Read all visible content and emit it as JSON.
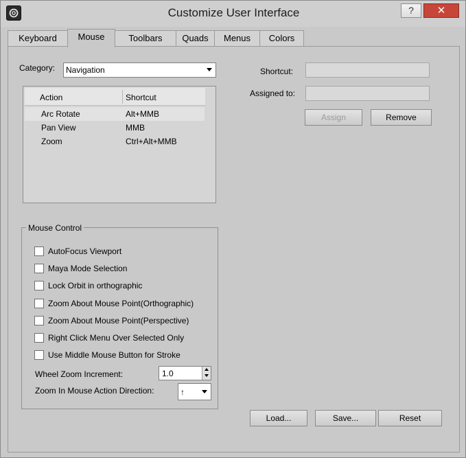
{
  "window": {
    "title": "Customize User Interface",
    "help_glyph": "?",
    "close_glyph": "✕"
  },
  "tabs": [
    {
      "label": "Keyboard"
    },
    {
      "label": "Mouse",
      "active": true
    },
    {
      "label": "Toolbars"
    },
    {
      "label": "Quads"
    },
    {
      "label": "Menus"
    },
    {
      "label": "Colors"
    }
  ],
  "category": {
    "label": "Category:",
    "value": "Navigation"
  },
  "action_list": {
    "columns": [
      "Action",
      "Shortcut"
    ],
    "rows": [
      {
        "action": "Arc Rotate",
        "shortcut": "Alt+MMB",
        "selected": true
      },
      {
        "action": "Pan View",
        "shortcut": "MMB"
      },
      {
        "action": "Zoom",
        "shortcut": "Ctrl+Alt+MMB"
      }
    ]
  },
  "shortcut": {
    "label": "Shortcut:",
    "value": ""
  },
  "assigned_to": {
    "label": "Assigned to:",
    "value": ""
  },
  "buttons": {
    "assign": "Assign",
    "remove": "Remove",
    "load": "Load...",
    "save": "Save...",
    "reset": "Reset"
  },
  "mouse_control": {
    "title": "Mouse Control",
    "options": [
      {
        "label": "AutoFocus Viewport",
        "checked": false
      },
      {
        "label": "Maya Mode Selection",
        "checked": false
      },
      {
        "label": "Lock Orbit in orthographic",
        "checked": false
      },
      {
        "label": "Zoom About Mouse Point(Orthographic)",
        "checked": false
      },
      {
        "label": "Zoom About Mouse Point(Perspective)",
        "checked": false
      },
      {
        "label": "Right Click Menu Over Selected Only",
        "checked": false
      },
      {
        "label": "Use Middle Mouse Button for Stroke",
        "checked": false
      }
    ],
    "wheel_zoom": {
      "label": "Wheel Zoom Increment:",
      "value": "1.0"
    },
    "zoom_direction": {
      "label": "Zoom In Mouse Action Direction:",
      "value": "↑"
    }
  }
}
